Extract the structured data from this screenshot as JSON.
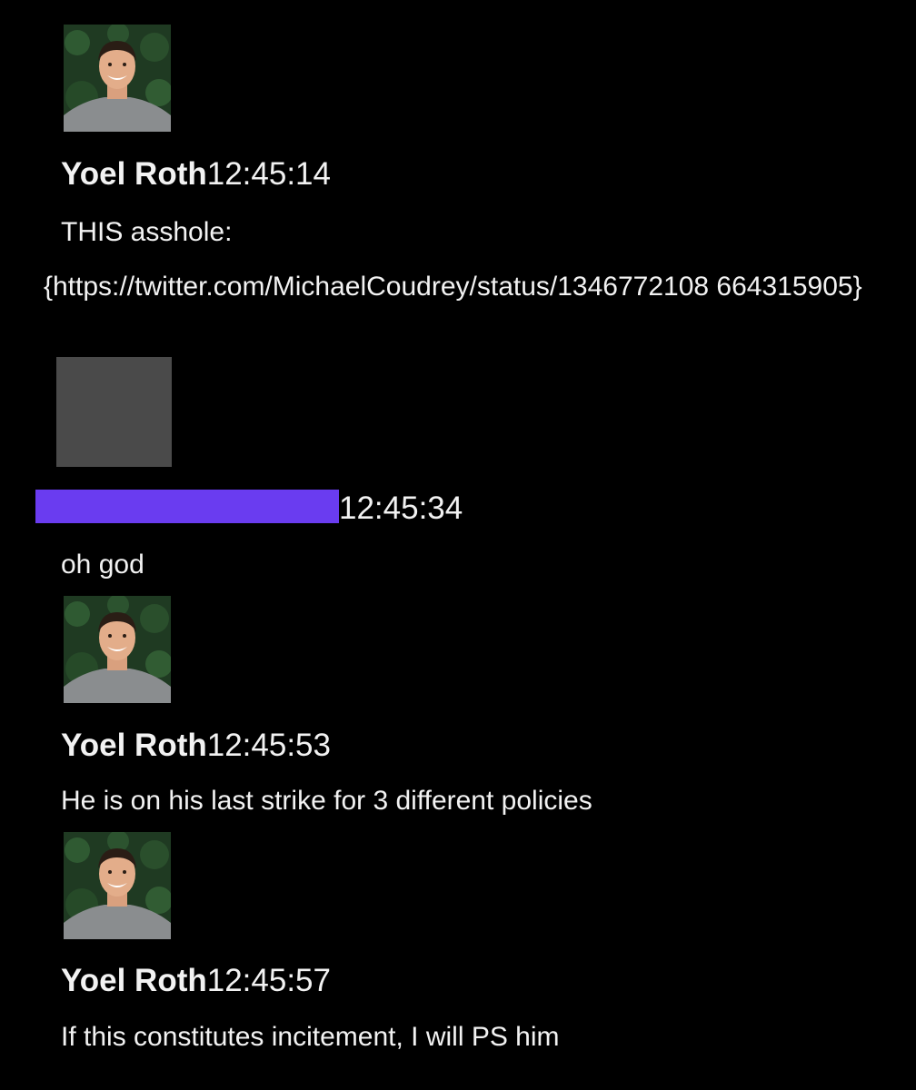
{
  "theme": {
    "background": "#000000",
    "text": "#f2f2f2",
    "redacted_avatar": "#4a4a4a",
    "redaction_bar": "#6a3cf0"
  },
  "messages": [
    {
      "sender": "Yoel Roth",
      "time": "12:45:14",
      "text": "THIS asshole:",
      "link": "{https://twitter.com/MichaelCoudrey/status/1346772108 664315905}",
      "avatar": "profile-photo"
    },
    {
      "sender": "",
      "time": "12:45:34",
      "text": "oh god",
      "avatar": "redacted-placeholder"
    },
    {
      "sender": "Yoel Roth",
      "time": "12:45:53",
      "text": "He is on his last strike for 3 different policies",
      "avatar": "profile-photo"
    },
    {
      "sender": "Yoel Roth",
      "time": "12:45:57",
      "text": "If this constitutes incitement, I will PS him",
      "avatar": "profile-photo"
    }
  ]
}
